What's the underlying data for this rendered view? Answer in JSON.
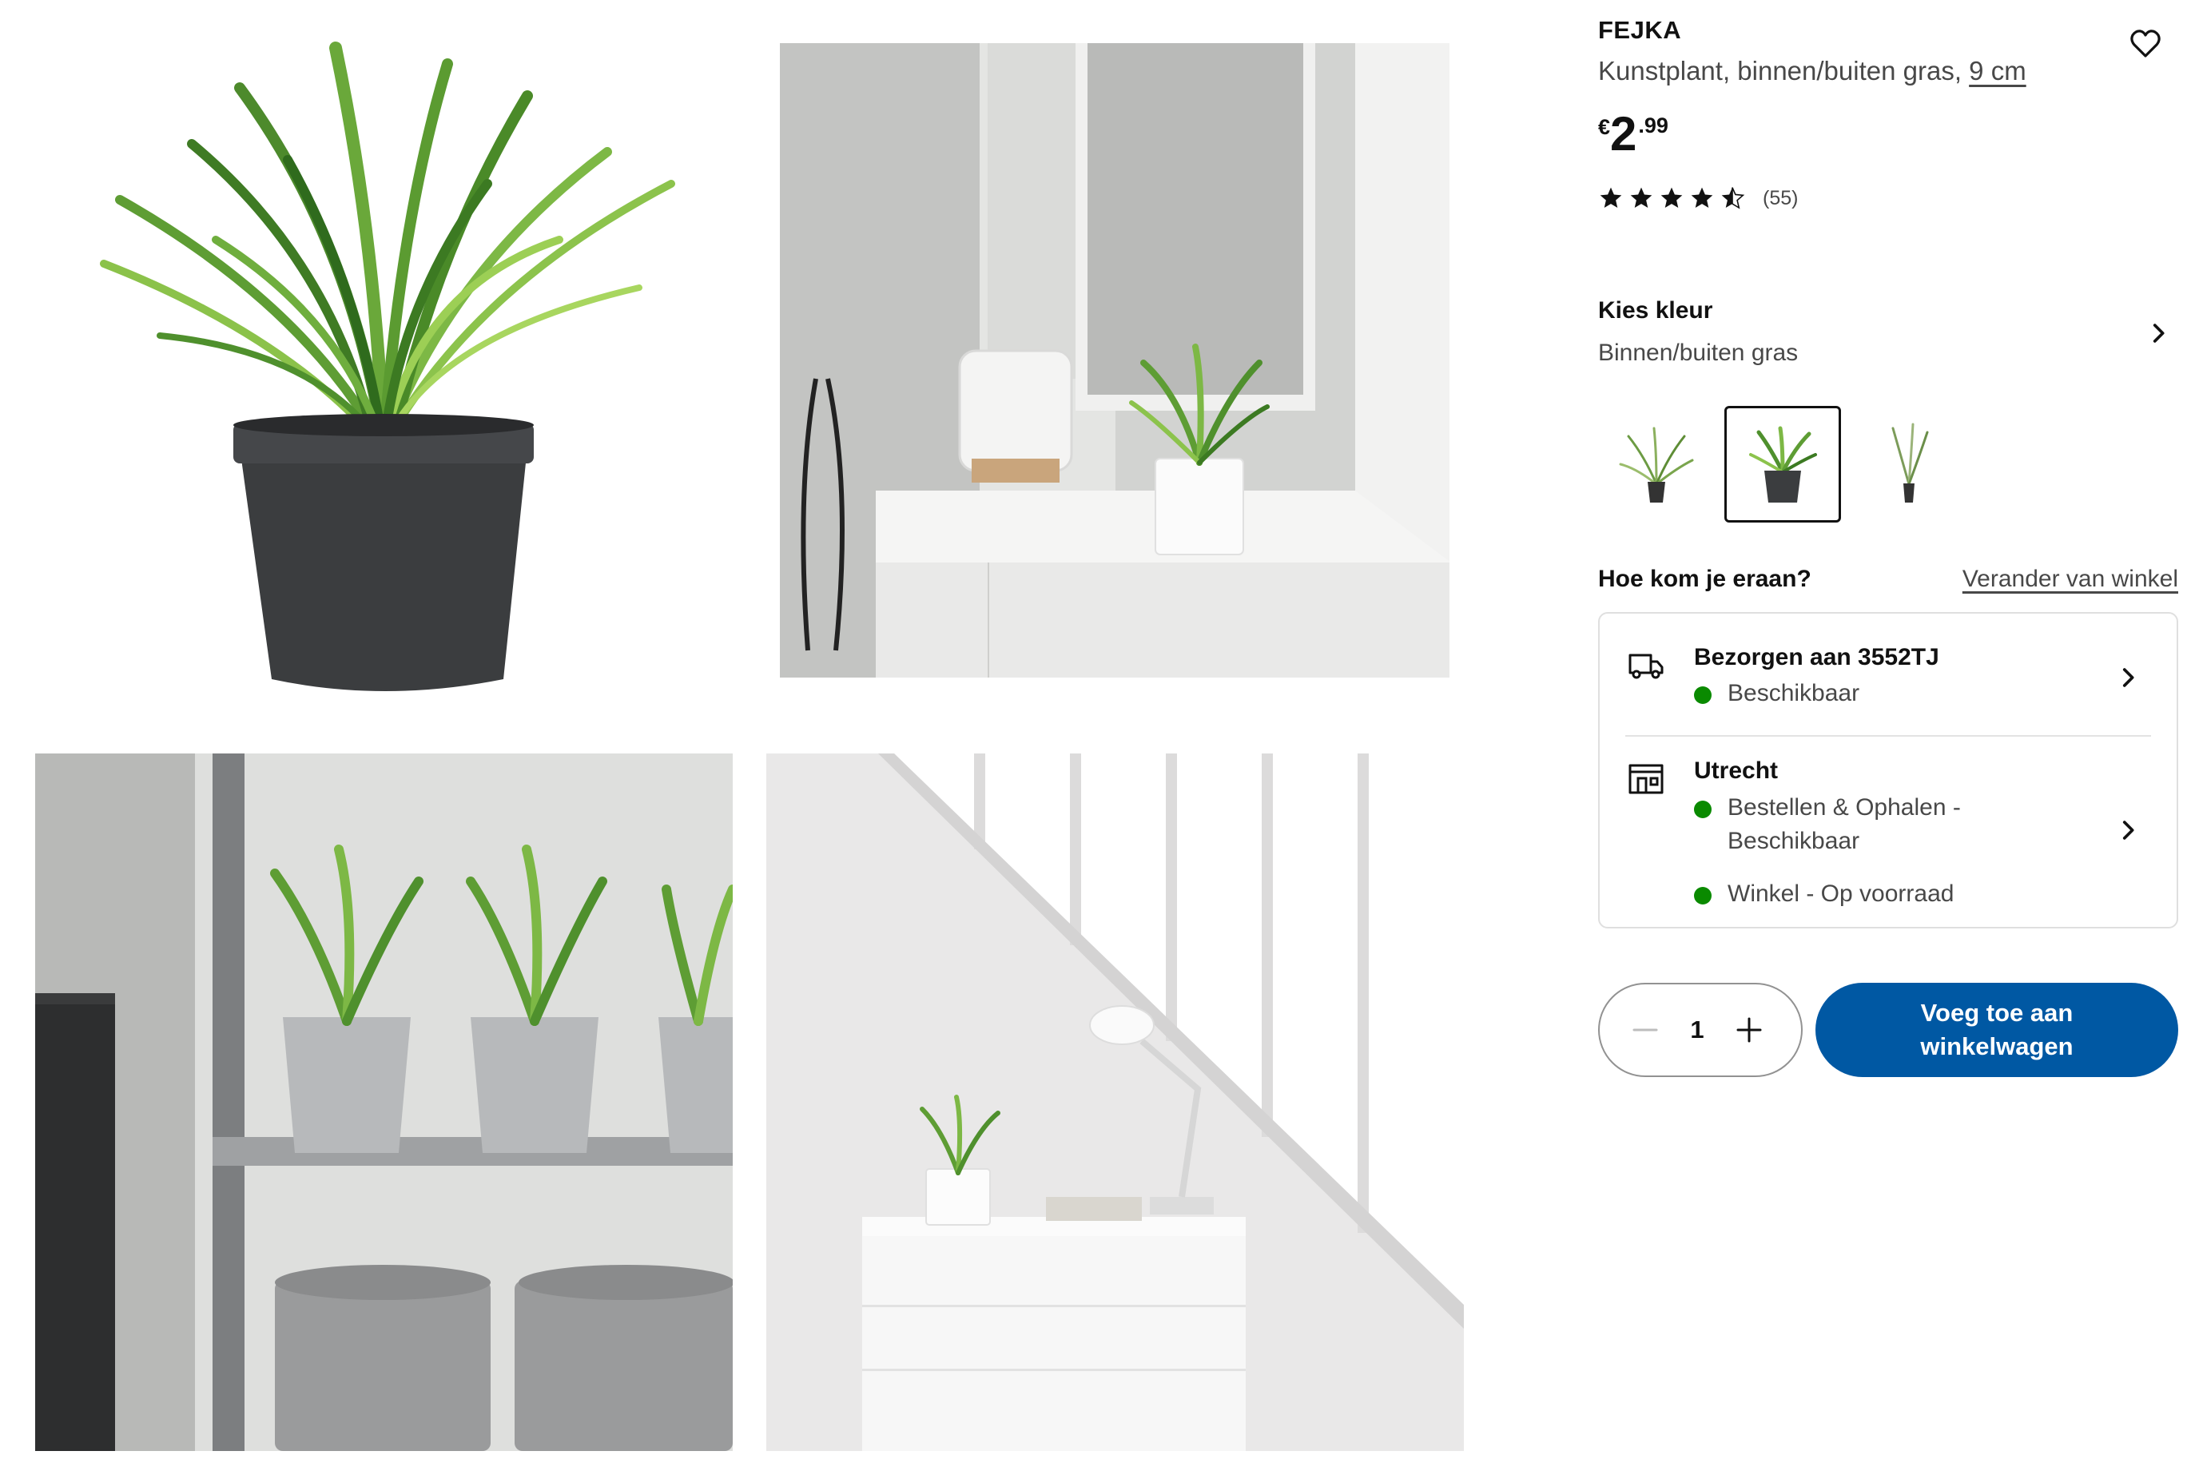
{
  "gallery": [
    {
      "alt": "product-photo-grass-black-pot"
    },
    {
      "alt": "hallway-cabinet-scene"
    },
    {
      "alt": "shelf-with-galvanized-pots"
    },
    {
      "alt": "staircase-dresser-scene"
    }
  ],
  "product": {
    "name": "FEJKA",
    "desc_prefix": "Kunstplant, binnen/buiten gras, ",
    "desc_size": "9 cm",
    "price_currency": "€",
    "price_int": "2",
    "price_dec": ".99",
    "rating_value": 4.5,
    "rating_count": "(55)"
  },
  "color": {
    "title": "Kies kleur",
    "selected": "Binnen/buiten gras",
    "variants": [
      "grass-tall-variant",
      "grass-black-pot-variant",
      "grass-slim-variant"
    ]
  },
  "availability": {
    "title": "Hoe kom je eraan?",
    "change_store": "Verander van winkel",
    "delivery": {
      "title": "Bezorgen aan 3552TJ",
      "status": "Beschikbaar"
    },
    "store": {
      "title": "Utrecht",
      "status1": "Bestellen & Ophalen -",
      "status1b": "Beschikbaar",
      "status2": "Winkel - Op voorraad"
    }
  },
  "cart": {
    "quantity": "1",
    "add_label": "Voeg toe aan\nwinkelwagen"
  },
  "colors": {
    "brand_blue": "#0058a3",
    "available_green": "#0a8a00"
  }
}
